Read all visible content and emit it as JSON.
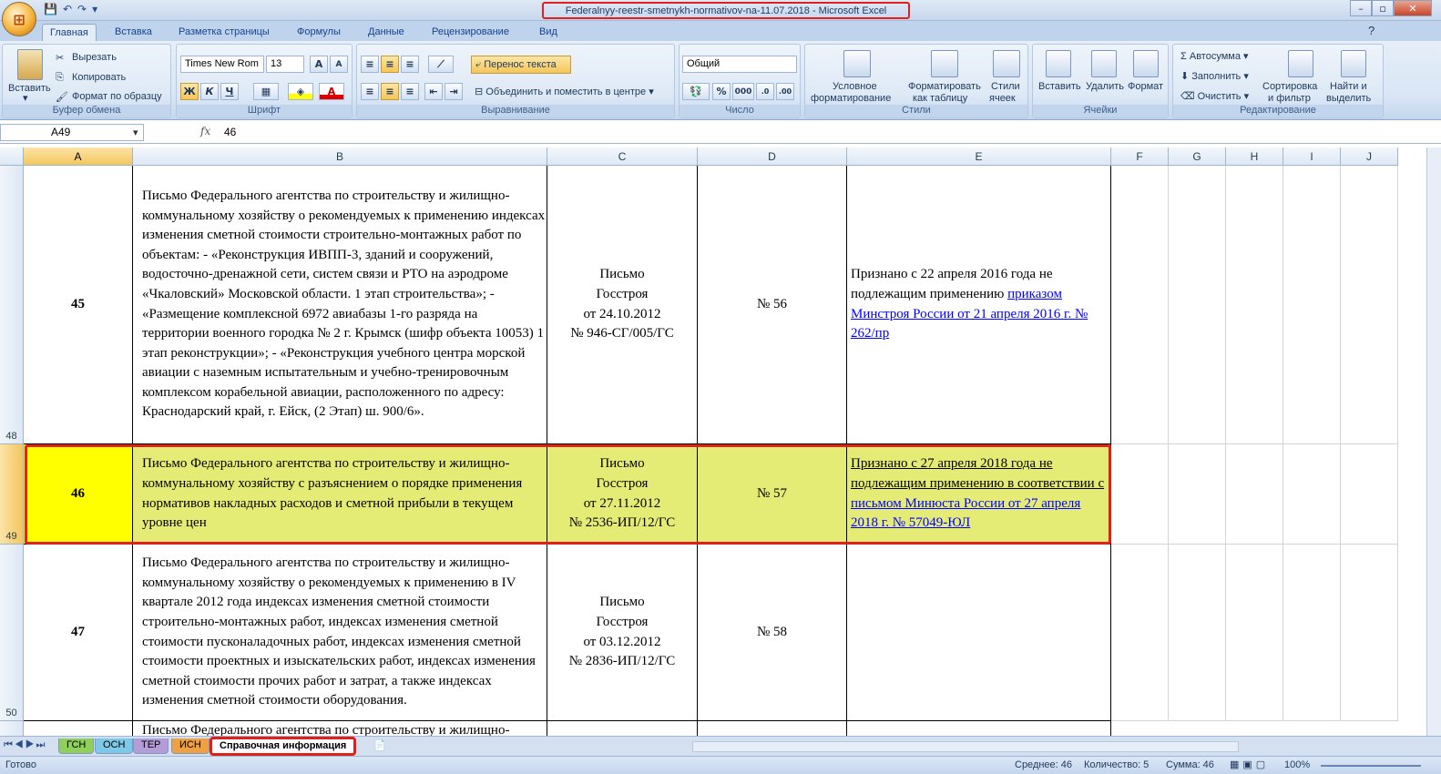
{
  "title": "Federalnyy-reestr-smetnykh-normativov-na-11.07.2018 - Microsoft Excel",
  "tabs": [
    "Главная",
    "Вставка",
    "Разметка страницы",
    "Формулы",
    "Данные",
    "Рецензирование",
    "Вид"
  ],
  "ribbon": {
    "clipboard": {
      "paste": "Вставить",
      "cut": "Вырезать",
      "copy": "Копировать",
      "format_painter": "Формат по образцу",
      "label": "Буфер обмена"
    },
    "font": {
      "name": "Times New Rom",
      "size": "13",
      "bold": "Ж",
      "italic": "К",
      "underline": "Ч",
      "label": "Шрифт"
    },
    "alignment": {
      "wrap": "Перенос текста",
      "merge": "Объединить и поместить в центре",
      "label": "Выравнивание"
    },
    "number": {
      "format": "Общий",
      "percent": "%",
      "thousands": "000",
      "label": "Число"
    },
    "styles": {
      "cond1": "Условное",
      "cond2": "форматирование",
      "table1": "Форматировать",
      "table2": "как таблицу",
      "cell1": "Стили",
      "cell2": "ячеек",
      "label": "Стили"
    },
    "cells": {
      "insert": "Вставить",
      "delete": "Удалить",
      "format": "Формат",
      "label": "Ячейки"
    },
    "editing": {
      "autosum": "Автосумма",
      "fill": "Заполнить",
      "clear": "Очистить",
      "sort1": "Сортировка",
      "sort2": "и фильтр",
      "find1": "Найти и",
      "find2": "выделить",
      "label": "Редактирование"
    }
  },
  "formula_bar": {
    "name_box": "A49",
    "fx": "fx",
    "value": "46"
  },
  "columns": [
    "A",
    "B",
    "C",
    "D",
    "E",
    "F",
    "G",
    "H",
    "I",
    "J"
  ],
  "rows": [
    {
      "num": "48",
      "a": "45",
      "b": "Письмо Федерального агентства по строительству и жилищно-коммунальному хозяйству о рекомендуемых к применению индексах изменения сметной стоимости строительно-монтажных работ по объектам: - «Реконструкция ИВПП-3, зданий и сооружений, водосточно-дренажной сети, систем связи и РТО на аэродроме «Чкаловский» Московской области. 1 этап строительства»; - «Размещение комплексной 6972 авиабазы 1-го разряда на территории военного городка № 2 г. Крымск (шифр объекта 10053) 1 этап реконструкции»; - «Реконструкция учебного центра морской авиации с наземным испытательным и учебно-тренировочным комплексом корабельной авиации, расположенного по адресу: Краснодарский край, г. Ейск, (2 Этап) ш. 900/6».",
      "c": [
        "Письмо",
        "Госстроя",
        "от 24.10.2012",
        "№ 946-СГ/005/ГС"
      ],
      "d": "№ 56",
      "e_text": "Признано с 22 апреля 2016 года не подлежащим применению ",
      "e_link": "приказом Минстроя России от 21 апреля 2016 г. № 262/пр"
    },
    {
      "num": "49",
      "a": "46",
      "b": "Письмо Федерального агентства по строительству и жилищно-коммунальному хозяйству с разъяснением о порядке применения нормативов накладных расходов и сметной прибыли в текущем уровне цен",
      "c": [
        "Письмо",
        "Госстроя",
        "от 27.11.2012",
        "№ 2536-ИП/12/ГС"
      ],
      "d": "№ 57",
      "e_text": "Признано с 27 апреля 2018 года не подлежащим применению в соответствии с ",
      "e_link": "письмом Минюста России от 27 апреля 2018 г. № 57049-ЮЛ"
    },
    {
      "num": "50",
      "a": "47",
      "b": "Письмо Федерального агентства по строительству и жилищно-коммунальному хозяйству о рекомендуемых к применению в IV квартале 2012 года индексах изменения сметной стоимости строительно-монтажных работ, индексах изменения сметной стоимости пусконаладочных работ, индексах изменения сметной стоимости проектных и изыскательских работ, индексах изменения сметной стоимости прочих работ и затрат, а также индексах изменения сметной стоимости оборудования.",
      "c": [
        "Письмо",
        "Госстроя",
        "от 03.12.2012",
        "№ 2836-ИП/12/ГС"
      ],
      "d": "№ 58",
      "e_text": "",
      "e_link": ""
    },
    {
      "num": "",
      "a": "",
      "b": "Письмо Федерального агентства по строительству и жилищно-",
      "c": [],
      "d": "",
      "e_text": "",
      "e_link": ""
    }
  ],
  "sheet_tabs": [
    "ГСН",
    "ОСН",
    "ТЕР",
    "ИСН",
    "Справочная информация"
  ],
  "status": {
    "ready": "Готово",
    "avg": "Среднее: 46",
    "count": "Количество: 5",
    "sum": "Сумма: 46",
    "zoom": "100%"
  }
}
